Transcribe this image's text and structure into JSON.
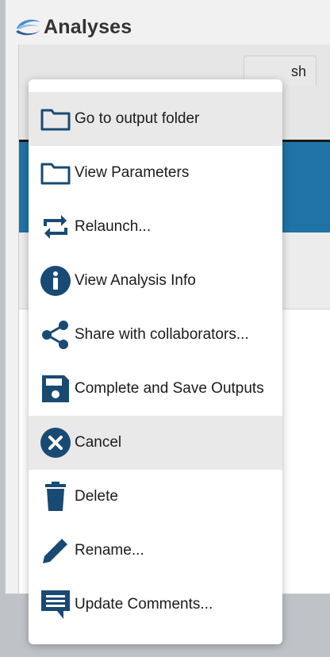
{
  "app": {
    "title": "Analyses"
  },
  "tab": {
    "label": "sh"
  },
  "colors": {
    "icon": "#194a73",
    "band": "#1f73a7",
    "highlight": "#e9e9e9"
  },
  "menu": {
    "items": [
      {
        "label": "Go to output folder",
        "icon": "folder-icon",
        "highlighted": true
      },
      {
        "label": "View Parameters",
        "icon": "folder-outline-icon",
        "highlighted": false
      },
      {
        "label": "Relaunch...",
        "icon": "repeat-icon",
        "highlighted": false
      },
      {
        "label": "View Analysis Info",
        "icon": "info-icon",
        "highlighted": false
      },
      {
        "label": "Share with collaborators...",
        "icon": "share-icon",
        "highlighted": false
      },
      {
        "label": "Complete and Save Outputs",
        "icon": "save-icon",
        "highlighted": false
      },
      {
        "label": "Cancel",
        "icon": "cancel-icon",
        "highlighted": true
      },
      {
        "label": "Delete",
        "icon": "trash-icon",
        "highlighted": false
      },
      {
        "label": "Rename...",
        "icon": "pencil-icon",
        "highlighted": false
      },
      {
        "label": "Update Comments...",
        "icon": "comment-icon",
        "highlighted": false
      }
    ]
  }
}
